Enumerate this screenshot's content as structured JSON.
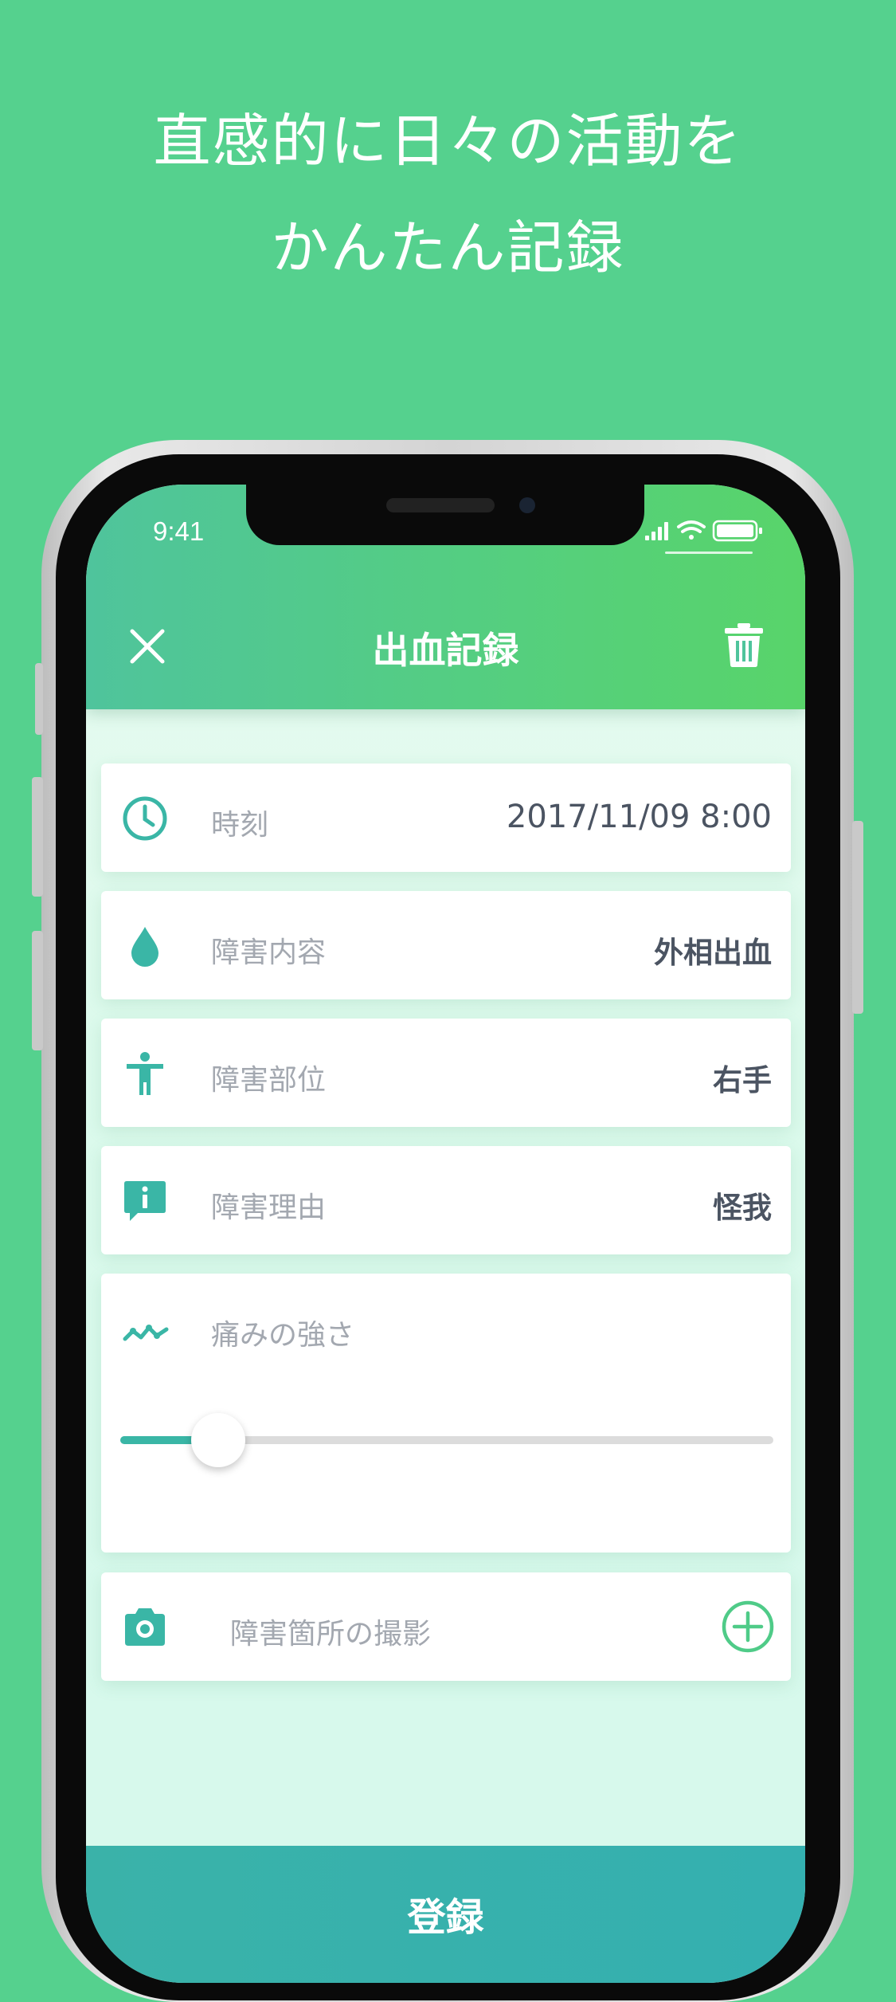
{
  "headline": {
    "line1": "直感的に日々の活動を",
    "line2": "かんたん記録"
  },
  "status_bar": {
    "time": "9:41"
  },
  "header": {
    "title": "出血記録",
    "close_icon": "close-icon",
    "delete_icon": "trash-icon"
  },
  "rows": [
    {
      "icon": "clock-icon",
      "label": "時刻",
      "value": "2017/11/09 8:00"
    },
    {
      "icon": "drop-icon",
      "label": "障害内容",
      "value": "外相出血"
    },
    {
      "icon": "person-icon",
      "label": "障害部位",
      "value": "右手"
    },
    {
      "icon": "info-bubble-icon",
      "label": "障害理由",
      "value": "怪我"
    }
  ],
  "pain": {
    "icon": "trend-icon",
    "label": "痛みの強さ",
    "level": 0.15
  },
  "photo": {
    "icon": "camera-icon",
    "label": "障害箇所の撮影",
    "add_icon": "plus-circle-icon"
  },
  "submit": {
    "label": "登録"
  },
  "colors": {
    "background": "#55d18e",
    "accent": "#3ab6a6",
    "header_start": "#4fc49c",
    "header_end": "#58d46a"
  }
}
